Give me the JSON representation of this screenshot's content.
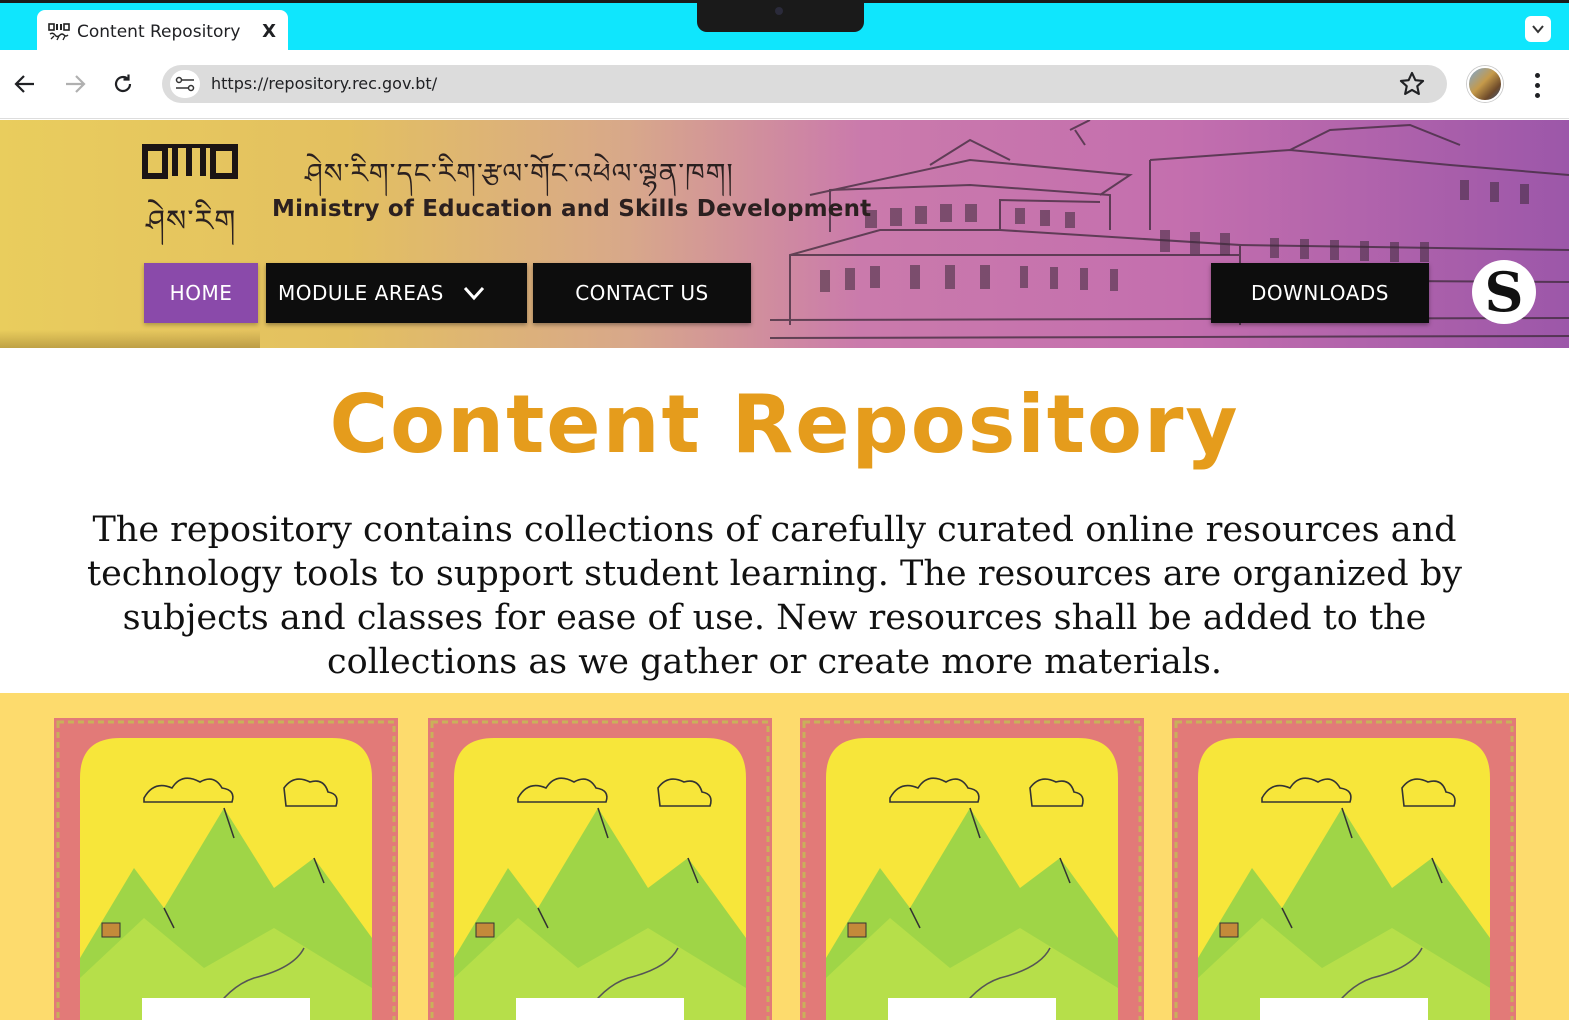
{
  "browser": {
    "tab_title": "Content Repository",
    "tab_close_label": "X",
    "url": "https://repository.rec.gov.bt/"
  },
  "header": {
    "logo_label": "ཤེས་རིག",
    "dzongkha_title": "ཤེས་རིག་དང་རིག་རྩལ་གོང་འཕེལ་ལྷན་ཁག།",
    "ministry_name": "Ministry of Education and Skills Development",
    "nav": {
      "home": "HOME",
      "module_areas": "MODULE AREAS",
      "contact_us": "CONTACT US",
      "downloads": "DOWNLOADS"
    },
    "badge_letter": "S"
  },
  "main": {
    "title": "Content Repository",
    "intro": "The repository contains collections of carefully curated online resources and technology tools to support student learning. The resources are organized by subjects and classes for ease of use. New resources shall be added to the collections as we gather or create more materials."
  },
  "cards": [
    {
      "image": "landscape-illustration"
    },
    {
      "image": "landscape-illustration"
    },
    {
      "image": "landscape-illustration"
    },
    {
      "image": "landscape-illustration"
    }
  ],
  "colors": {
    "tabstrip": "#0fe6fd",
    "home_button": "#8a4aaa",
    "nav_button": "#0d0d0d",
    "title_orange": "#e59c1c",
    "cards_background": "#fddb6d",
    "card_border": "#e27a78",
    "card_fill": "#f7e63a"
  }
}
